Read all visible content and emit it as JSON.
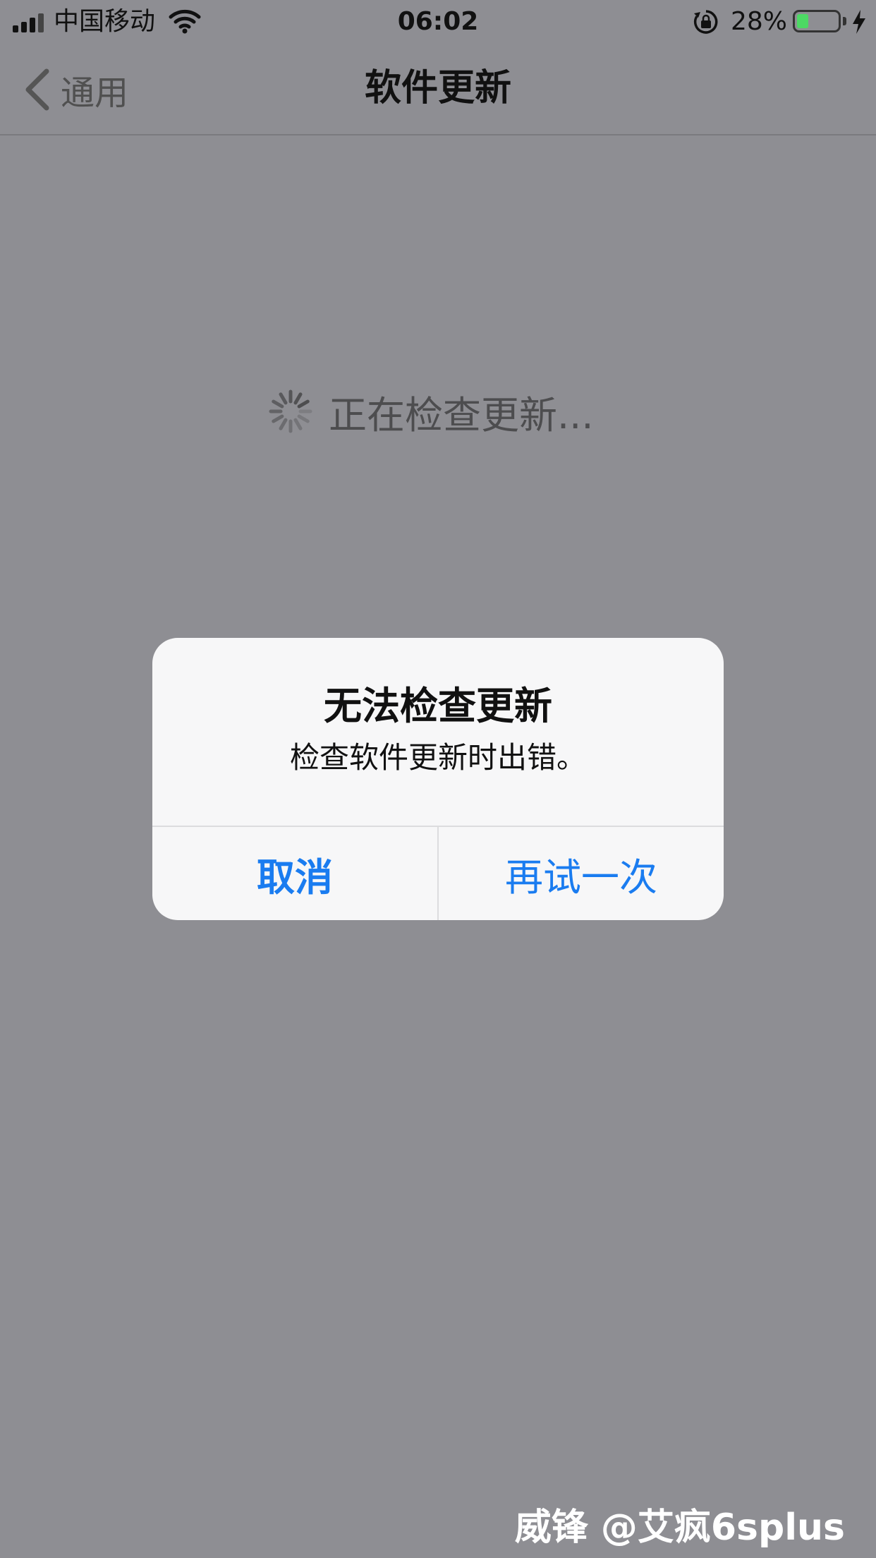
{
  "status_bar": {
    "carrier": "中国移动",
    "time": "06:02",
    "battery_percent": "28%",
    "battery_level": 0.28,
    "charging": true,
    "orientation_lock": true
  },
  "nav": {
    "back_label": "通用",
    "title": "软件更新"
  },
  "content": {
    "checking_label": "正在检查更新..."
  },
  "alert": {
    "title": "无法检查更新",
    "message": "检查软件更新时出错。",
    "cancel_label": "取消",
    "retry_label": "再试一次"
  },
  "watermark": {
    "text": "威锋 @艾疯6splus"
  },
  "colors": {
    "accent": "#1a7cf0",
    "battery": "#4cd964",
    "dim_background": "#8e8e93"
  }
}
